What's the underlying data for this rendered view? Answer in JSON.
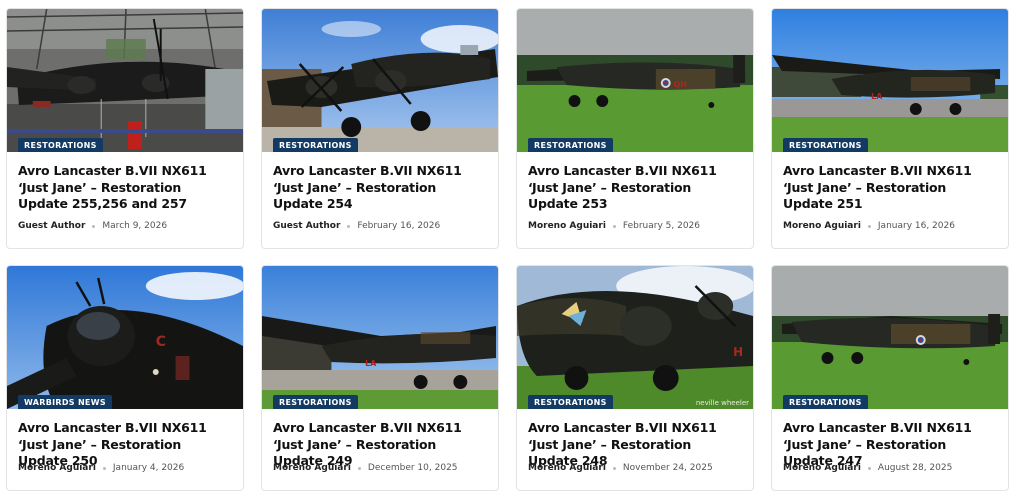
{
  "cards": [
    {
      "category": "Restorations",
      "title": "Avro Lancaster B.VII NX611 ‘Just Jane’ – Restoration Update 255,256 and 257",
      "author": "Guest Author",
      "date": "March 9, 2026",
      "watermark": ""
    },
    {
      "category": "Restorations",
      "title": "Avro Lancaster B.VII NX611 ‘Just Jane’ – Restoration Update 254",
      "author": "Guest Author",
      "date": "February 16, 2026",
      "watermark": ""
    },
    {
      "category": "Restorations",
      "title": "Avro Lancaster B.VII NX611 ‘Just Jane’ – Restoration Update 253",
      "author": "Moreno Aguiari",
      "date": "February 5, 2026",
      "watermark": ""
    },
    {
      "category": "Restorations",
      "title": "Avro Lancaster B.VII NX611 ‘Just Jane’ – Restoration Update 251",
      "author": "Moreno Aguiari",
      "date": "January 16, 2026",
      "watermark": ""
    },
    {
      "category": "Warbirds News",
      "title": "Avro Lancaster B.VII NX611 ‘Just Jane’ – Restoration Update 250",
      "author": "Moreno Aguiari",
      "date": "January 4, 2026",
      "watermark": ""
    },
    {
      "category": "Restorations",
      "title": "Avro Lancaster B.VII NX611 ‘Just Jane’ – Restoration Update 249",
      "author": "Moreno Aguiari",
      "date": "December 10, 2025",
      "watermark": ""
    },
    {
      "category": "Restorations",
      "title": "Avro Lancaster B.VII NX611 ‘Just Jane’ – Restoration Update 248",
      "author": "Moreno Aguiari",
      "date": "November 24, 2025",
      "watermark": "neville wheeler"
    },
    {
      "category": "Restorations",
      "title": "Avro Lancaster B.VII NX611 ‘Just Jane’ – Restoration Update 247",
      "author": "Moreno Aguiari",
      "date": "August 28, 2025",
      "watermark": ""
    }
  ],
  "colors": {
    "badge": "#123a63",
    "title": "#111111",
    "meta": "#555555",
    "card_border": "#e3e3e3"
  }
}
